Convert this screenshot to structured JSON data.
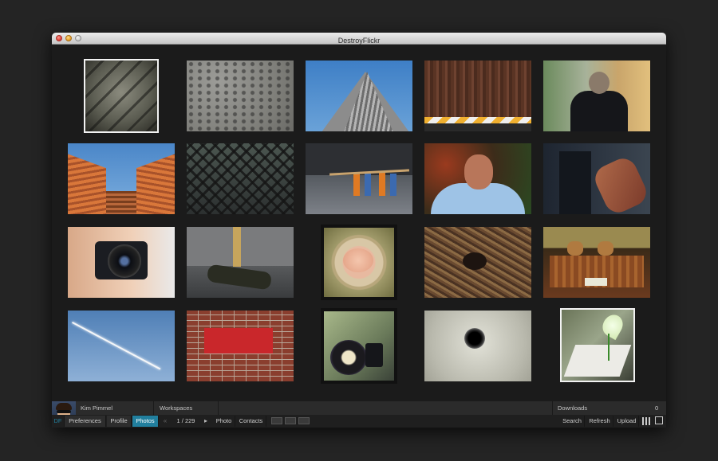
{
  "window": {
    "title": "DestroyFlickr"
  },
  "user": {
    "name": "Kim Pimmel"
  },
  "tabs": {
    "workspaces": "Workspaces"
  },
  "downloads": {
    "label": "Downloads",
    "count": "0"
  },
  "toolbar": {
    "df": "DF",
    "preferences": "Preferences",
    "profile": "Profile",
    "photos": "Photos",
    "prev_glyph": "«",
    "pager": "1 / 229",
    "next_glyph": "▸",
    "photo": "Photo",
    "contacts": "Contacts",
    "search": "Search",
    "refresh": "Refresh",
    "upload": "Upload"
  },
  "colors": {
    "accent": "#217f9e",
    "background": "#1b1b1b"
  },
  "icons": [
    "grid-view-icon",
    "fullscreen-icon"
  ]
}
